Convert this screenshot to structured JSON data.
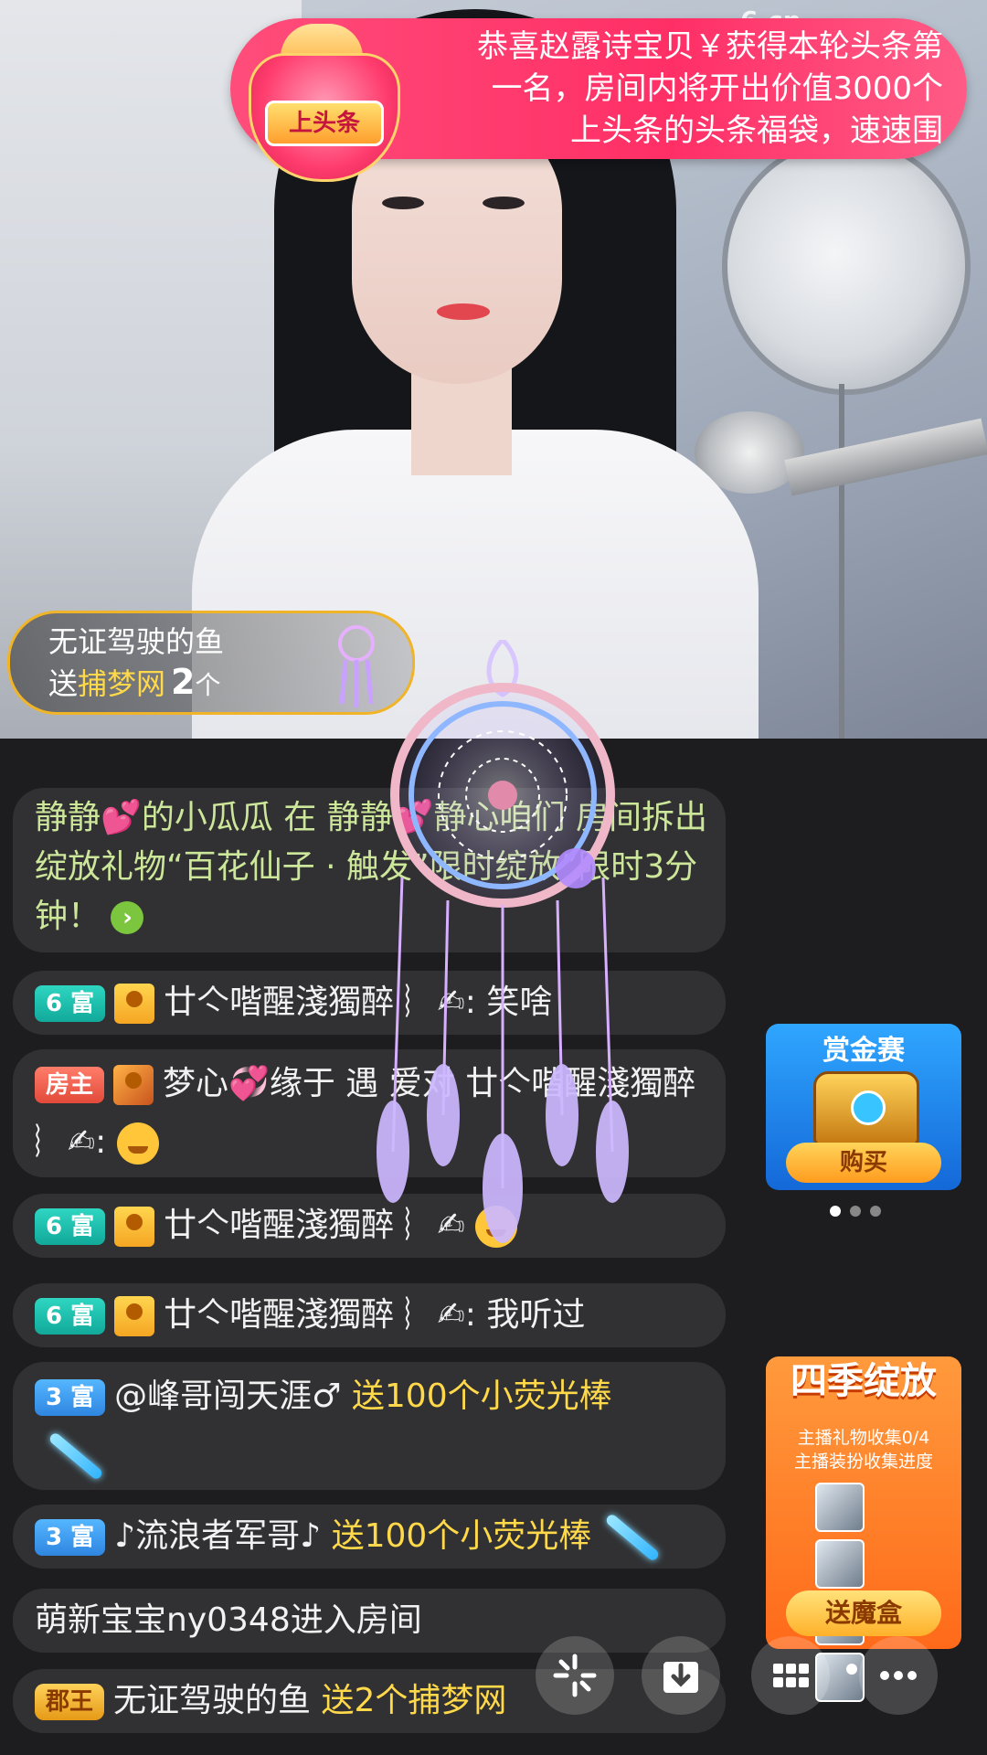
{
  "banner": {
    "text": "恭喜赵露诗宝贝￥获得本轮头条第一名，房间内将开出价值3000个上头条的头条福袋，速速围",
    "bag_label": "上头条",
    "site_logo": "6.cn"
  },
  "gift_toast": {
    "user": "无证驾驶的鱼",
    "verb": "送",
    "gift_name": "捕梦网",
    "count": "2",
    "unit": "个"
  },
  "chat": {
    "system_msg": {
      "text": "静静💕的小瓜瓜 在 静静💕静心咱们 房间拆出绽放礼物“百花仙子 · 触发”限时绽放”限时3分钟！"
    },
    "messages": [
      {
        "badge": "6 富",
        "user": "廿亽喈醒淺獨醉 ︴✍",
        "text": ": 笑啥"
      },
      {
        "badge": "房主",
        "user": "梦心",
        "text": "缘于 遇 爱对 廿亽喈醒淺獨醉 ︴✍:"
      },
      {
        "badge": "6 富",
        "user": "廿亽喈醒淺獨醉 ︴✍",
        "text": ""
      },
      {
        "badge": "6 富",
        "user": "廿亽喈醒淺獨醉 ︴✍",
        "text": ": 我听过"
      },
      {
        "badge": "3 富",
        "user": "@峰哥闯天涯♂",
        "text": "送100个小荧光棒"
      },
      {
        "badge": "3 富",
        "user": "♪流浪者军哥♪",
        "text": "送100个小荧光棒"
      },
      {
        "badge": "",
        "user": "",
        "text": "萌新宝宝ny0348进入房间"
      },
      {
        "badge": "郡王",
        "user": "无证驾驶的鱼",
        "text": "送2个捕梦网"
      }
    ]
  },
  "side": {
    "bounty_title": "赏金赛",
    "bounty_button": "购买",
    "season_title": "四季绽放",
    "season_line1": "主播礼物收集0/4",
    "season_line2": "主播装扮收集进度",
    "season_button": "送魔盒"
  },
  "toolbar": {
    "icons": [
      "sparkle-icon",
      "download-icon",
      "grid-icon",
      "more-icon"
    ]
  }
}
